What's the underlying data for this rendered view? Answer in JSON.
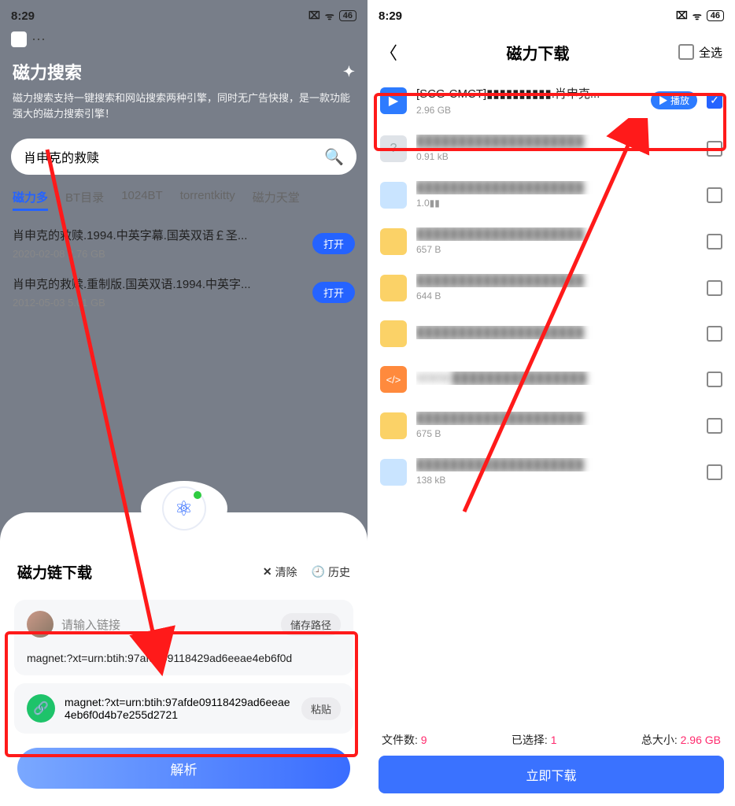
{
  "status": {
    "time": "8:29",
    "battery": "46"
  },
  "left": {
    "title": "磁力搜索",
    "subtitle": "磁力搜索支持一键搜索和网站搜索两种引擎，同时无广告快搜，是一款功能强大的磁力搜索引擎！",
    "search_value": "肖申克的救赎",
    "tabs": [
      "磁力多",
      "BT目录",
      "1024BT",
      "torrentkitty",
      "磁力天堂"
    ],
    "active_tab": 0,
    "results": [
      {
        "title": "肖申克的救赎.1994.中英字幕.国英双语￡圣...",
        "meta": "2020-02-08 2.76 GB",
        "open": "打开"
      },
      {
        "title": "肖申克的救赎.重制版.国英双语.1994.中英字...",
        "meta": "2012-05-03 5.01 GB",
        "open": "打开"
      }
    ],
    "sheet": {
      "title": "磁力链下载",
      "clear": "清除",
      "history": "历史",
      "placeholder": "请输入链接",
      "path_btn": "储存路径",
      "magnet_display": "magnet:?xt=urn:btih:97afde09118429ad6eeae4eb6f0d",
      "magnet_paste": "magnet:?xt=urn:btih:97afde09118429ad6eeae4eb6f0d4b7e255d2721",
      "paste_btn": "粘贴",
      "parse_btn": "解析"
    }
  },
  "right": {
    "title": "磁力下载",
    "select_all": "全选",
    "files": [
      {
        "icon": "play",
        "name": "[SCG-CMCT]▮▮▮▮▮▮▮▮▮▮.肖申克...",
        "size": "2.96 GB",
        "play": "播放",
        "checked": true,
        "blur": false
      },
      {
        "icon": "q",
        "name": "████████████████████",
        "size": "0.91 kB",
        "checked": false,
        "blur": true
      },
      {
        "icon": "img",
        "name": "████████████████████",
        "size": "1.0▮▮",
        "checked": false,
        "blur": true
      },
      {
        "icon": "fold",
        "name": "████████████████████",
        "size": "657 B",
        "checked": false,
        "blur": true
      },
      {
        "icon": "fold",
        "name": "████████████████████",
        "size": "644 B",
        "checked": false,
        "blur": true
      },
      {
        "icon": "fold",
        "name": "████████████████████",
        "size": "",
        "checked": false,
        "blur": true
      },
      {
        "icon": "code",
        "name": "WWW.████████████████",
        "size": "",
        "checked": false,
        "blur": true
      },
      {
        "icon": "fold",
        "name": "████████████████████",
        "size": "675 B",
        "checked": false,
        "blur": true
      },
      {
        "icon": "img",
        "name": "████████████████████",
        "size": "138 kB",
        "checked": false,
        "blur": true
      }
    ],
    "summary": {
      "count_label": "文件数:",
      "count": "9",
      "sel_label": "已选择:",
      "sel": "1",
      "size_label": "总大小:",
      "size": "2.96 GB"
    },
    "download_btn": "立即下载"
  }
}
